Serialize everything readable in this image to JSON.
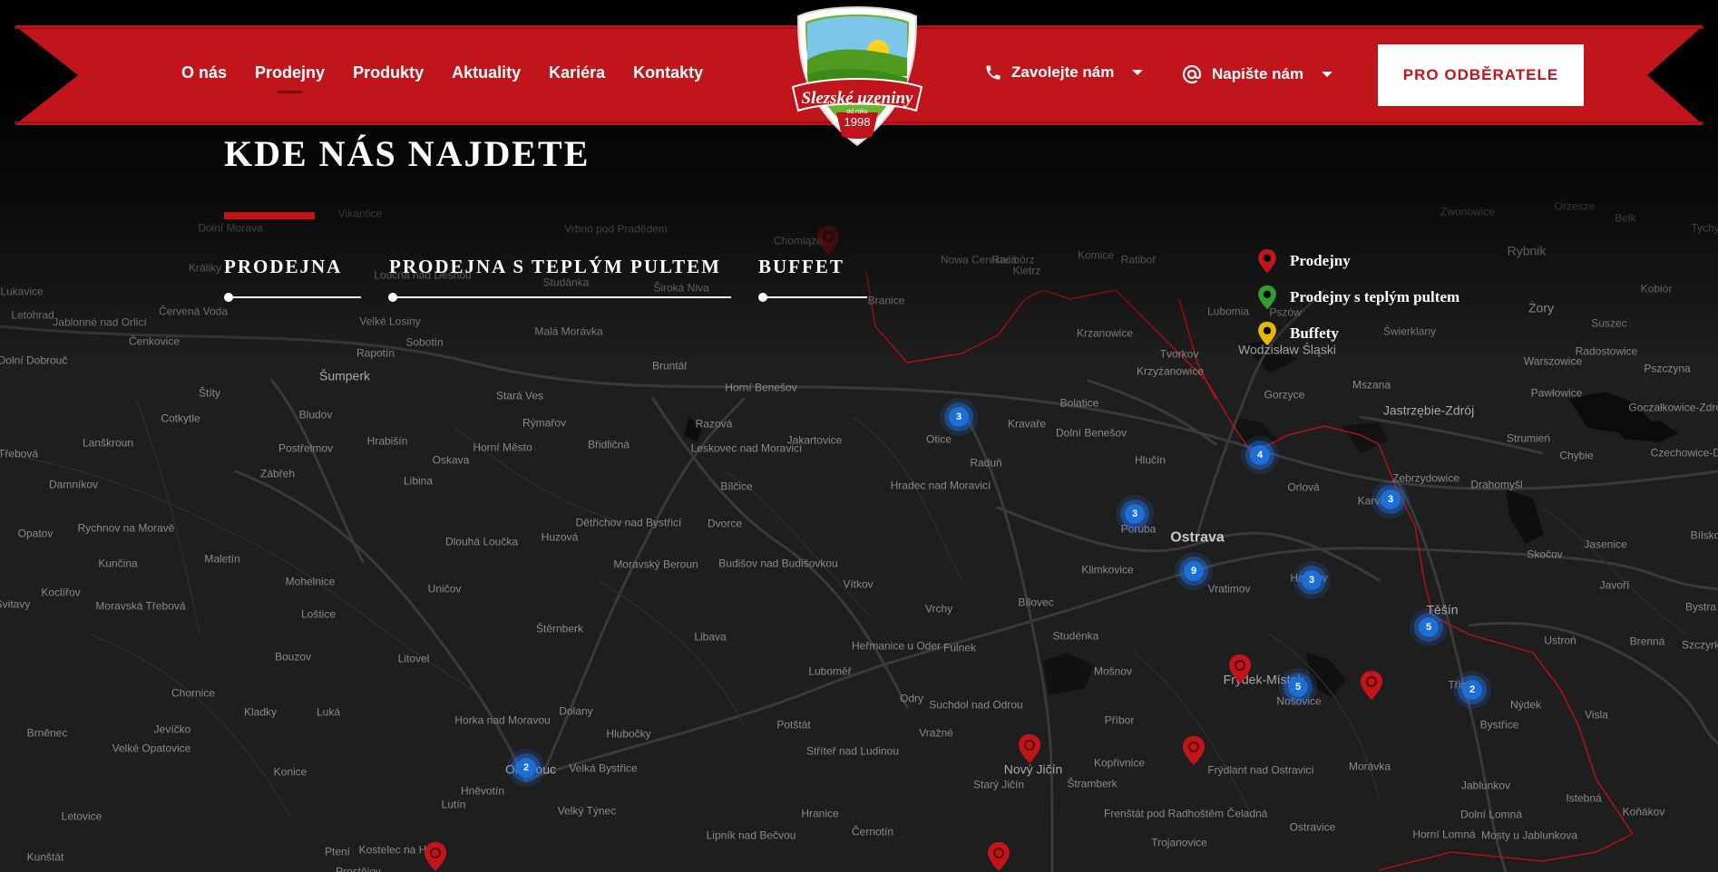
{
  "nav": {
    "items": [
      "O nás",
      "Prodejny",
      "Produkty",
      "Aktuality",
      "Kariéra",
      "Kontakty"
    ],
    "active": "Prodejny"
  },
  "logo": {
    "brand": "Slezské uzeniny",
    "since": "od roku",
    "year": "1998"
  },
  "contact": {
    "call": "Zavolejte nám",
    "write": "Napište nám"
  },
  "cta": "PRO ODBĚRATELE",
  "page_title": "KDE NÁS NAJDETE",
  "tabs": [
    "PRODEJNA",
    "PRODEJNA S TEPLÝM PULTEM",
    "BUFFET"
  ],
  "legend": {
    "items": [
      {
        "label": "Prodejny",
        "color": "#c1151c"
      },
      {
        "label": "Prodejny s teplým pultem",
        "color": "#2e9e2e"
      },
      {
        "label": "Buffety",
        "color": "#e6b800"
      }
    ]
  },
  "map": {
    "towns": [
      [
        "Šumperk",
        "mid"
      ],
      [
        "Rapotín",
        ""
      ],
      [
        "Velké Losiny",
        ""
      ],
      [
        "Sobotín",
        ""
      ],
      [
        "Malá Morávka",
        ""
      ],
      [
        "Bruntál",
        ""
      ],
      [
        "Horní Benešov",
        ""
      ],
      [
        "Otice",
        ""
      ],
      [
        "Kravaře",
        ""
      ],
      [
        "Bolatice",
        ""
      ],
      [
        "Dolní Benešov",
        ""
      ],
      [
        "Hlučín",
        ""
      ],
      [
        "Ostrava",
        "big"
      ],
      [
        "Orlová",
        ""
      ],
      [
        "Karviná",
        ""
      ],
      [
        "Havířov",
        ""
      ],
      [
        "Klimkovice",
        ""
      ],
      [
        "Vratimov",
        ""
      ],
      [
        "Frýdek-Místek",
        "mid"
      ],
      [
        "Nošovice",
        ""
      ],
      [
        "Třinec",
        ""
      ],
      [
        "Těšín",
        "mid"
      ],
      [
        "Bystřice",
        ""
      ],
      [
        "Nýdek",
        ""
      ],
      [
        "Nový Jičín",
        "mid"
      ],
      [
        "Olomouc",
        "mid"
      ],
      [
        "Velká Bystřice",
        ""
      ],
      [
        "Hlubočky",
        ""
      ],
      [
        "Dolany",
        ""
      ],
      [
        "Štěrnberk",
        ""
      ],
      [
        "Libava",
        ""
      ],
      [
        "Moravský Beroun",
        ""
      ],
      [
        "Budišov nad Budišovkou",
        ""
      ],
      [
        "Vítkov",
        ""
      ],
      [
        "Fulnek",
        ""
      ],
      [
        "Bílovec",
        ""
      ],
      [
        "Studénka",
        ""
      ],
      [
        "Příbor",
        ""
      ],
      [
        "Kopřivnice",
        ""
      ],
      [
        "Frýdlant nad Ostravicí",
        ""
      ],
      [
        "Morávka",
        ""
      ],
      [
        "Jablunkov",
        ""
      ],
      [
        "Jastrzębie-Zdrój",
        "mid"
      ],
      [
        "Wodzisław Śląski",
        "mid"
      ],
      [
        "Racibórz",
        ""
      ],
      [
        "Pszczyna",
        ""
      ],
      [
        "Zebrzydowice",
        ""
      ],
      [
        "Gorzyce",
        ""
      ],
      [
        "Krzyżanowice",
        ""
      ],
      [
        "Tvorkov",
        ""
      ],
      [
        "Krzanowice",
        ""
      ],
      [
        "Kietrz",
        ""
      ],
      [
        "Branice",
        ""
      ],
      [
        "Bludov",
        ""
      ],
      [
        "Postřelmov",
        ""
      ],
      [
        "Zábřeh",
        ""
      ],
      [
        "Lanškroun",
        ""
      ],
      [
        "Hrabišín",
        ""
      ],
      [
        "Oskava",
        ""
      ],
      [
        "Libina",
        ""
      ],
      [
        "Uničov",
        ""
      ],
      [
        "Litovel",
        ""
      ],
      [
        "Loštice",
        ""
      ],
      [
        "Mohelnice",
        ""
      ],
      [
        "Bouzov",
        ""
      ],
      [
        "Konice",
        ""
      ],
      [
        "Hněvotín",
        ""
      ],
      [
        "Lutín",
        ""
      ],
      [
        "Velký Týnec",
        ""
      ],
      [
        "Prostějov",
        ""
      ],
      [
        "Chornice",
        ""
      ],
      [
        "Kladky",
        ""
      ],
      [
        "Luká",
        ""
      ],
      [
        "Jevíčko",
        ""
      ],
      [
        "Velké Opatovice",
        ""
      ],
      [
        "Letovice",
        ""
      ],
      [
        "Kunštát",
        ""
      ],
      [
        "Kostelec na Hané",
        ""
      ],
      [
        "Ptení",
        ""
      ],
      [
        "Hranice",
        ""
      ],
      [
        "Lipník nad Bečvou",
        ""
      ],
      [
        "Potštát",
        ""
      ],
      [
        "Luboměř",
        ""
      ],
      [
        "Heřmanice u Oder",
        ""
      ],
      [
        "Odry",
        ""
      ],
      [
        "Suchdol nad Odrou",
        ""
      ],
      [
        "Vražné",
        ""
      ],
      [
        "Štramberk",
        ""
      ],
      [
        "Mošnov",
        ""
      ],
      [
        "Stříteř nad Ludinou",
        ""
      ],
      [
        "Starý Jičín",
        ""
      ],
      [
        "Černotín",
        ""
      ],
      [
        "Frenštát pod Radhoštěm",
        ""
      ],
      [
        "Čeladná",
        ""
      ],
      [
        "Ostravice",
        ""
      ],
      [
        "Trojanovice",
        ""
      ],
      [
        "Horní Lomná",
        ""
      ],
      [
        "Dolní Lomná",
        ""
      ],
      [
        "Mosty u Jablunkova",
        ""
      ],
      [
        "Istebná",
        ""
      ],
      [
        "Koňákov",
        ""
      ],
      [
        "Visla",
        ""
      ],
      [
        "Ustroń",
        ""
      ],
      [
        "Brenná",
        ""
      ],
      [
        "Skočov",
        ""
      ],
      [
        "Jasenice",
        ""
      ],
      [
        "Javoří",
        ""
      ],
      [
        "Czechowice-Dziedzice",
        ""
      ],
      [
        "Chybie",
        ""
      ],
      [
        "Strumień",
        ""
      ],
      [
        "Drahomyšl",
        ""
      ],
      [
        "Goczałkowice-Zdrój",
        ""
      ],
      [
        "Pawłowice",
        ""
      ],
      [
        "Warszowice",
        ""
      ],
      [
        "Radostowice",
        ""
      ],
      [
        "Suszec",
        ""
      ],
      [
        "Żory",
        "mid"
      ],
      [
        "Mszana",
        ""
      ],
      [
        "Świerklany",
        ""
      ],
      [
        "Lubomia",
        ""
      ],
      [
        "Pszów",
        ""
      ],
      [
        "Rybnik",
        "mid"
      ],
      [
        "Orzesze",
        ""
      ],
      [
        "Kobiór",
        ""
      ],
      [
        "Bełk",
        ""
      ],
      [
        "Zwonowice",
        ""
      ],
      [
        "Nowa Cerekwia",
        ""
      ],
      [
        "Komice",
        ""
      ],
      [
        "Studánka",
        ""
      ],
      [
        "Široká Niva",
        ""
      ],
      [
        "Loučná nad Desnou",
        ""
      ],
      [
        "Vikantice",
        ""
      ],
      [
        "Dolní Morava",
        ""
      ],
      [
        "Králiky",
        ""
      ],
      [
        "Lukavice",
        ""
      ],
      [
        "Letohrad",
        ""
      ],
      [
        "Jablonné nad Orlicí",
        ""
      ],
      [
        "Červená Voda",
        ""
      ],
      [
        "Čenkovice",
        ""
      ],
      [
        "Dolní Dobrouč",
        ""
      ],
      [
        "Štíty",
        ""
      ],
      [
        "Cotkytle",
        ""
      ],
      [
        "Třebová",
        ""
      ],
      [
        "Damníkov",
        ""
      ],
      [
        "Rychnov na Moravě",
        ""
      ],
      [
        "Opatov",
        ""
      ],
      [
        "Kunčina",
        ""
      ],
      [
        "Koclířov",
        ""
      ],
      [
        "Moravská Třebová",
        ""
      ],
      [
        "Svitavy",
        ""
      ],
      [
        "Maletín",
        ""
      ],
      [
        "Brněnec",
        ""
      ],
      [
        "Hradec nad Moravicí",
        ""
      ],
      [
        "Raduň",
        ""
      ],
      [
        "Jakartovice",
        ""
      ],
      [
        "Leskovec nad Moravicí",
        ""
      ],
      [
        "Razová",
        ""
      ],
      [
        "Bílčice",
        ""
      ],
      [
        "Dětřichov nad Bystřicí",
        ""
      ],
      [
        "Dvorce",
        ""
      ],
      [
        "Huzová",
        ""
      ],
      [
        "Dlouhá Loučka",
        ""
      ],
      [
        "Horka nad Moravou",
        ""
      ],
      [
        "Stará Ves",
        ""
      ],
      [
        "Rýmařov",
        ""
      ],
      [
        "Břidličná",
        ""
      ],
      [
        "Horní Město",
        ""
      ],
      [
        "Vrbno pod Pradědem",
        ""
      ],
      [
        "Chomiąża",
        ""
      ],
      [
        "Ratiboř",
        ""
      ],
      [
        "Vrchy",
        ""
      ],
      [
        "Bílsko",
        ""
      ],
      [
        "Bystra",
        ""
      ],
      [
        "Szczyrk",
        ""
      ],
      [
        "Tychy",
        ""
      ],
      [
        "Poruba",
        ""
      ]
    ]
  }
}
